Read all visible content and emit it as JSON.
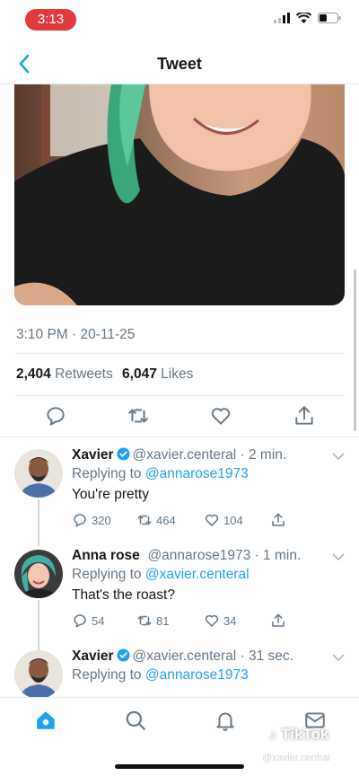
{
  "status": {
    "time": "3:13"
  },
  "nav": {
    "title": "Tweet"
  },
  "tweet": {
    "meta": "3:10 PM · 20-11-25",
    "retweets_count": "2,404",
    "retweets_label": "Retweets",
    "likes_count": "6,047",
    "likes_label": "Likes"
  },
  "replies": [
    {
      "name": "Xavier",
      "handle": "@xavier.centeral · 2 min.",
      "replying_prefix": "Replying to",
      "replying_to": "@annarose1973",
      "text": "You're pretty",
      "replies": "320",
      "retweets": "464",
      "likes": "104"
    },
    {
      "name": "Anna rose",
      "handle": "@annarose1973 · 1 min.",
      "replying_prefix": "Replying to",
      "replying_to": "@xavier.centeral",
      "text": "That's the roast?",
      "replies": "54",
      "retweets": "81",
      "likes": "34"
    },
    {
      "name": "Xavier",
      "handle": "@xavier.centeral · 31 sec.",
      "replying_prefix": "Replying to",
      "replying_to": "@annarose1973"
    }
  ],
  "watermark": {
    "brand": "TikTok",
    "user": "@xavier.central"
  },
  "colors": {
    "accent": "#1da1f2",
    "muted": "#657786",
    "pill": "#e0393e"
  }
}
